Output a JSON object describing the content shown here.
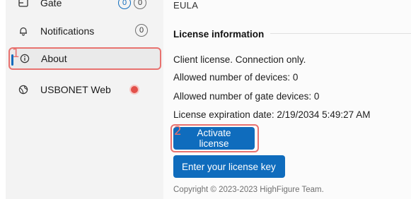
{
  "sidebar": {
    "items": [
      {
        "label": "Gate",
        "icon": "gate-icon",
        "badges": [
          "0",
          "0"
        ]
      },
      {
        "label": "Notifications",
        "icon": "bell-icon",
        "badge": "0"
      },
      {
        "label": "About",
        "icon": "info-icon",
        "selected": true
      },
      {
        "label": "USBONET Web",
        "icon": "globe-icon",
        "status": "red-dot"
      }
    ]
  },
  "annotations": {
    "marker_1": "1",
    "marker_2": "2"
  },
  "main": {
    "eula_link": "EULA",
    "license_section": {
      "title": "License information",
      "client_license": "Client license. Connection only.",
      "allowed_devices": "Allowed number of devices: 0",
      "allowed_gate_devices": "Allowed number of gate devices: 0",
      "expiration": "License expiration date: 2/19/2034 5:49:27 AM"
    },
    "buttons": {
      "activate_label": "Activate license",
      "enter_key_label": "Enter your license key"
    },
    "copyright": "Copyright © 2023-2023 HighFigure Team."
  },
  "colors": {
    "accent": "#0f6cbd",
    "annotation": "#e8726f",
    "status_dot": "#e2504a",
    "sidebar_bg": "#f3f3f3"
  }
}
